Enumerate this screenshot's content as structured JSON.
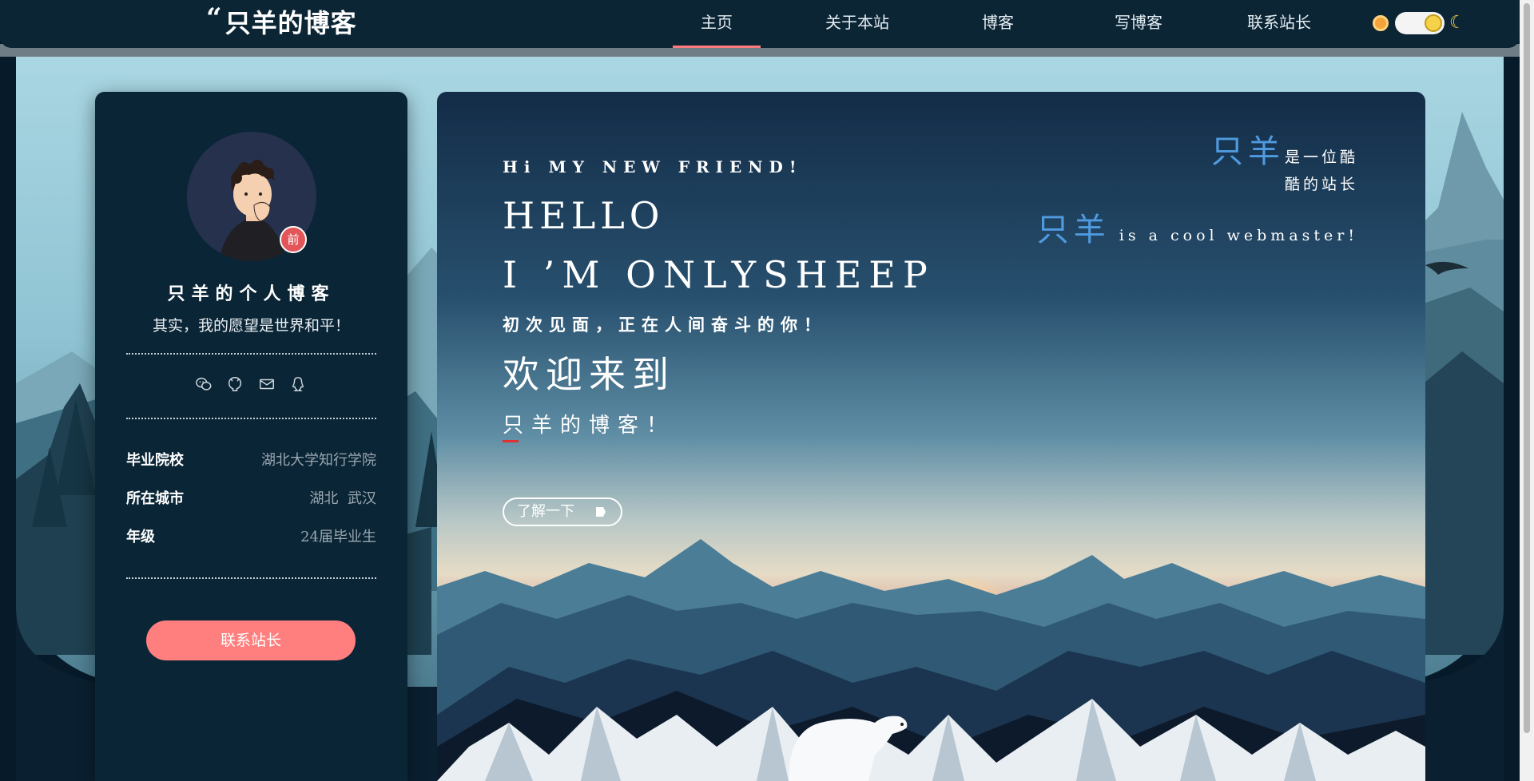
{
  "header": {
    "logo_quote": "“",
    "logo_text": "只羊的博客",
    "nav": [
      "主页",
      "关于本站",
      "博客",
      "写博客",
      "联系站长"
    ],
    "active_nav": "主页",
    "theme": "day"
  },
  "profile": {
    "title": "只羊的个人博客",
    "motto": "其实，我的愿望是世界和平！",
    "badge": "前",
    "social_icons": [
      "wechat-icon",
      "github-icon",
      "mail-icon",
      "qq-icon"
    ],
    "info": [
      {
        "key": "毕业院校",
        "value": "湖北大学知行学院"
      },
      {
        "key": "所在城市",
        "value": "湖北  武汉"
      },
      {
        "key": "年级",
        "value": "24届毕业生"
      }
    ],
    "contact_label": "联系站长"
  },
  "hero": {
    "hi": "Hi MY NEW FRIEND!",
    "hello": "HELLO",
    "im": "I ’M ONLYSHEEP",
    "first_meet": "初次见面，正在人间奋斗的你！",
    "welcome": "欢迎来到",
    "blog_name": "只羊的博客！",
    "learn_more": "了解一下",
    "right_highlight_1": "只羊",
    "right_text_1a": "是一位酷",
    "right_text_1b": "酷的站长",
    "right_highlight_2": "只羊",
    "right_text_2": "is a cool webmaster!"
  },
  "colors": {
    "nav_bg": "#0b2535",
    "card_bg": "#0a2536",
    "accent": "#ff7f7f",
    "highlight_blue": "#4f9be0"
  }
}
